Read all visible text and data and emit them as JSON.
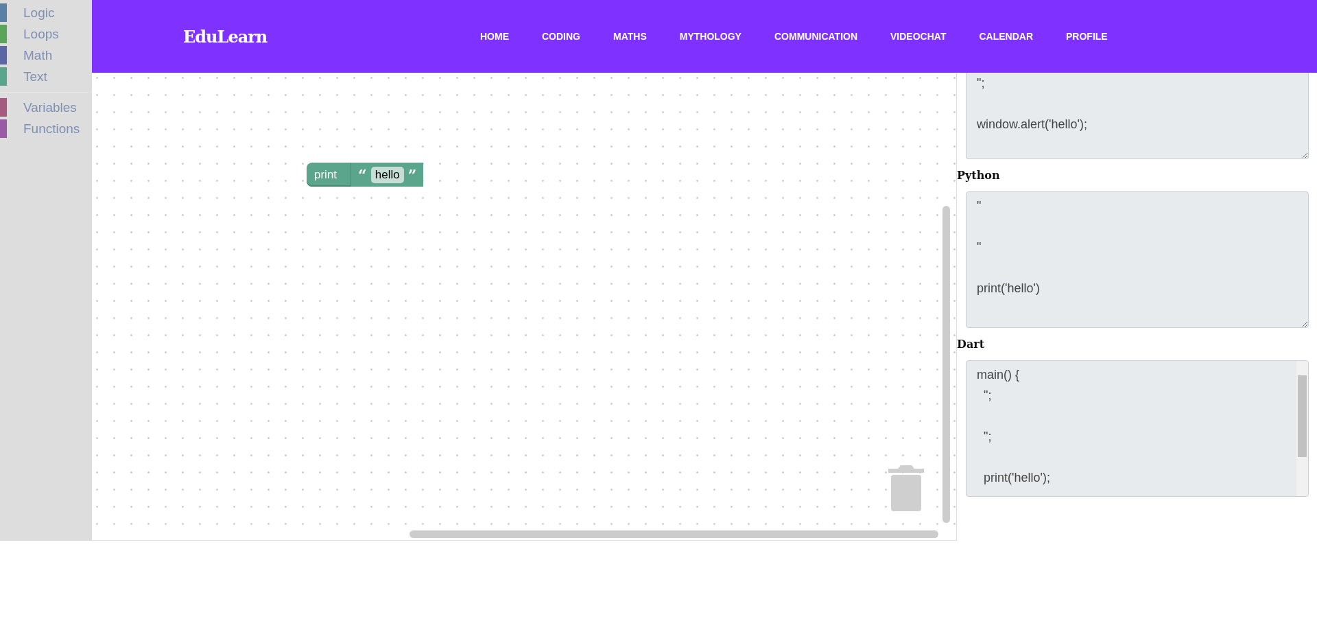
{
  "sidebar": {
    "groups": [
      {
        "items": [
          {
            "label": "Logic",
            "color": "#5b80a5"
          },
          {
            "label": "Loops",
            "color": "#5ba55b"
          },
          {
            "label": "Math",
            "color": "#5b67a5"
          },
          {
            "label": "Text",
            "color": "#5ba58c"
          }
        ]
      },
      {
        "items": [
          {
            "label": "Variables",
            "color": "#a55b80"
          },
          {
            "label": "Functions",
            "color": "#995ba5"
          }
        ]
      }
    ]
  },
  "header": {
    "logo": "EduLearn",
    "nav": [
      "HOME",
      "CODING",
      "MATHS",
      "MYTHOLOGY",
      "COMMUNICATION",
      "VIDEOCHAT",
      "CALENDAR",
      "PROFILE"
    ]
  },
  "workspace": {
    "blocks": [
      {
        "kind": "print",
        "label": "print",
        "input": {
          "kind": "text",
          "open_quote": "“",
          "value": "hello",
          "close_quote": "”"
        }
      }
    ]
  },
  "code_panel": {
    "sections": [
      {
        "code": "\";\n\nwindow.alert('hello');",
        "cut_top": true,
        "scrollable": false
      },
      {
        "heading": "Python",
        "code": "\"\n\n\"\n\nprint('hello')",
        "cut_top": false,
        "scrollable": false
      },
      {
        "heading": "Dart",
        "code": "main() {\n  \";\n\n  \";\n\n  print('hello');",
        "cut_top": false,
        "scrollable": true
      }
    ]
  }
}
